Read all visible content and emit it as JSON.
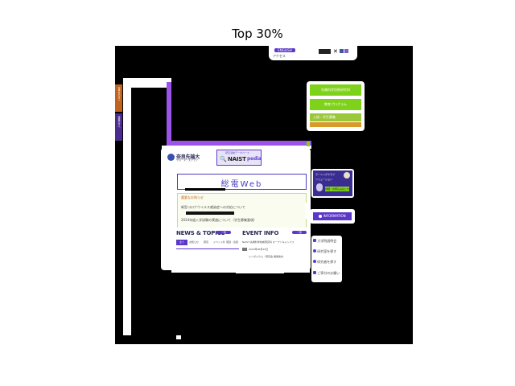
{
  "figure": {
    "title": "Top 30%"
  },
  "header": {
    "top_button": "ENGLISH",
    "top_links": "アクセス",
    "social_icons": [
      "x-icon",
      "facebook-icon",
      "youtube-icon"
    ]
  },
  "left_tabs": [
    "在学生の方へ",
    "企業の方へ"
  ],
  "logos": {
    "nara_logo": "奈良先端大",
    "nara_sub": "サポーターズクラブ",
    "naist_brand": "NAIST",
    "naist_suffix": "pedia",
    "naist_caption": "研究活動データベース"
  },
  "hero": {
    "title": "総電Web"
  },
  "notice": {
    "title": "重要なお知らせ",
    "lines": [
      "新型コロナウイルス感染症への対応について",
      "2024年度入学試験の実施について（学生募集要項）"
    ]
  },
  "news": {
    "title": "NEWS & TOPICS",
    "more": "一覧",
    "tabs": [
      "全て",
      "お知らせ",
      "研究",
      "イベント情報",
      "受賞・表彰"
    ]
  },
  "events": {
    "title": "EVENT INFO",
    "more": "一覧",
    "items": [
      "NAIST 先端科学技術研究科 オープンキャンパス",
      "2024年06月15日",
      "シンポジウム・研究会 開催案内"
    ]
  },
  "right_promo": {
    "top_line": "先端科学技術研究科",
    "mid_line": "教育プログラム",
    "bottom_line": "入試・学生募集"
  },
  "learning": {
    "line1": "ラーニングクラブ",
    "line2": "ソリューション",
    "btn": "詳細・お申込みはこちら"
  },
  "info_button": "INFORMATION",
  "side_links": [
    "大学院説明会",
    "研究室を探す",
    "研究者を探す",
    "ご寄付のお願い"
  ]
}
